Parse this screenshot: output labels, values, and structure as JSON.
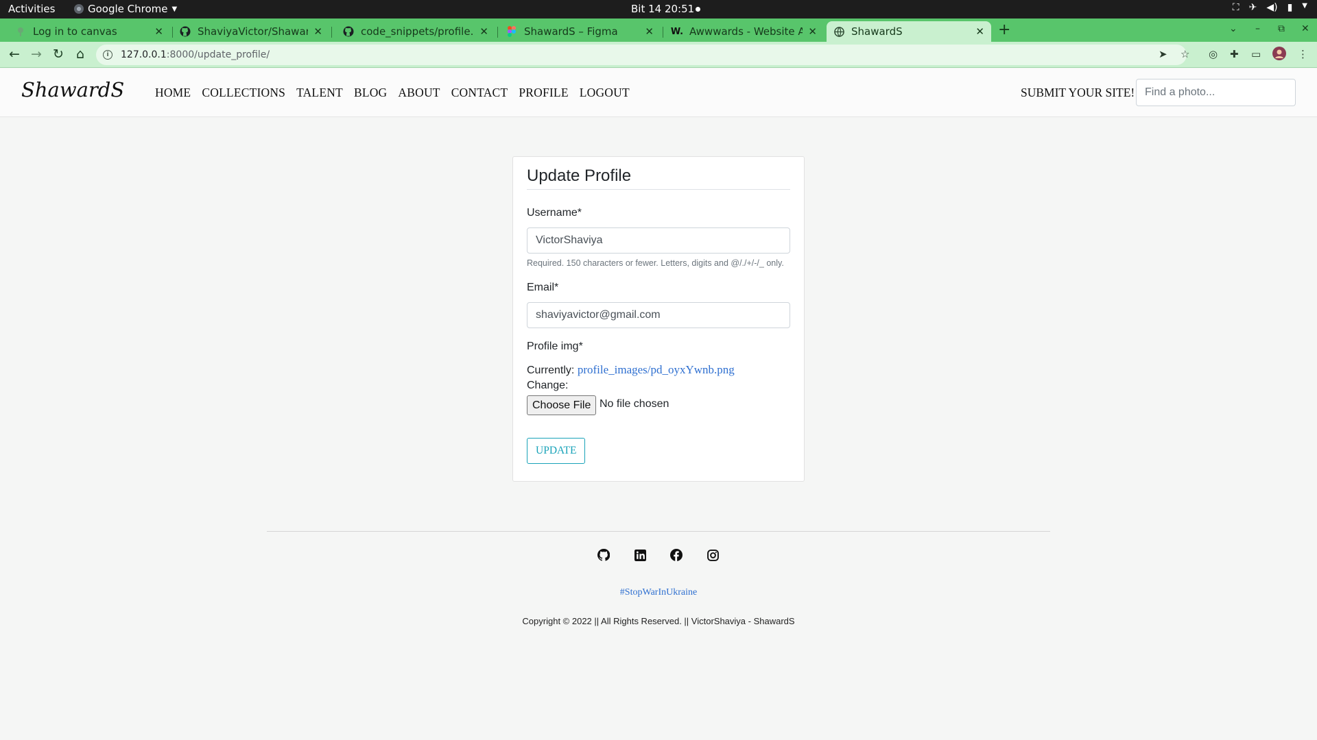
{
  "os_bar": {
    "activities": "Activities",
    "app_name": "Google Chrome",
    "clock": "Bit 14  20:51"
  },
  "browser": {
    "tabs": [
      {
        "title": "Log in to canvas",
        "icon": "canvas-icon"
      },
      {
        "title": "ShaviyaVictor/ShawardS:",
        "icon": "github-icon"
      },
      {
        "title": "code_snippets/profile.htm",
        "icon": "github-icon"
      },
      {
        "title": "ShawardS – Figma",
        "icon": "figma-icon"
      },
      {
        "title": "Awwwards - Website Awa",
        "icon": "awwwards-icon"
      },
      {
        "title": "ShawardS",
        "icon": "globe-icon"
      }
    ],
    "active_tab_index": 5,
    "url_host": "127.0.0.1",
    "url_path": ":8000/update_profile/",
    "accent_color": "#58c56b"
  },
  "site": {
    "brand": "ShawardS",
    "nav": [
      "HOME",
      "COLLECTIONS",
      "TALENT",
      "BLOG",
      "ABOUT",
      "CONTACT",
      "PROFILE",
      "LOGOUT"
    ],
    "submit_label": "SUBMIT YOUR SITE!",
    "search_placeholder": "Find a photo..."
  },
  "form": {
    "title": "Update Profile",
    "username_label": "Username*",
    "username_value": "VictorShaviya",
    "username_help": "Required. 150 characters or fewer. Letters, digits and @/./+/-/_ only.",
    "email_label": "Email*",
    "email_value": "shaviyavictor@gmail.com",
    "img_label": "Profile img*",
    "currently_label": "Currently:",
    "currently_value": "profile_images/pd_oyxYwnb.png",
    "change_label": "Change:",
    "choose_file": "Choose File",
    "no_file": "No file chosen",
    "submit": "UPDATE"
  },
  "footer": {
    "social": [
      "github-icon",
      "linkedin-icon",
      "facebook-icon",
      "instagram-icon"
    ],
    "hashtag": "#StopWarInUkraine",
    "copyright": "Copyright © 2022 || All Rights Reserved. || VictorShaviya - ShawardS"
  }
}
